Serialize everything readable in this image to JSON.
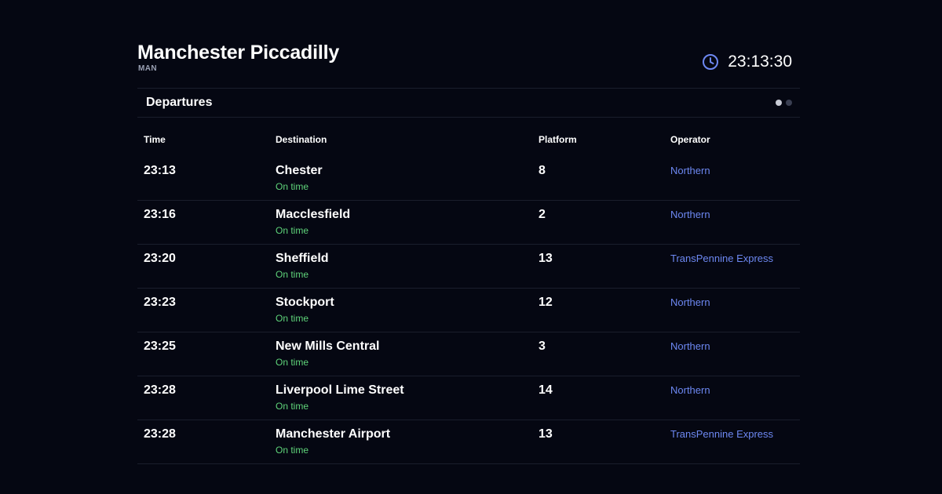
{
  "station": {
    "name": "Manchester Piccadilly",
    "code": "MAN"
  },
  "clock": {
    "time": "23:13:30",
    "icon": "clock-icon",
    "accent_color": "#6d88f2"
  },
  "section": {
    "title": "Departures",
    "pages": 2,
    "active_page": 1
  },
  "columns": {
    "time": "Time",
    "destination": "Destination",
    "platform": "Platform",
    "operator": "Operator"
  },
  "departures": [
    {
      "time": "23:13",
      "destination": "Chester",
      "status": "On time",
      "platform": "8",
      "operator": "Northern"
    },
    {
      "time": "23:16",
      "destination": "Macclesfield",
      "status": "On time",
      "platform": "2",
      "operator": "Northern"
    },
    {
      "time": "23:20",
      "destination": "Sheffield",
      "status": "On time",
      "platform": "13",
      "operator": "TransPennine Express"
    },
    {
      "time": "23:23",
      "destination": "Stockport",
      "status": "On time",
      "platform": "12",
      "operator": "Northern"
    },
    {
      "time": "23:25",
      "destination": "New Mills Central",
      "status": "On time",
      "platform": "3",
      "operator": "Northern"
    },
    {
      "time": "23:28",
      "destination": "Liverpool Lime Street",
      "status": "On time",
      "platform": "14",
      "operator": "Northern"
    },
    {
      "time": "23:28",
      "destination": "Manchester Airport",
      "status": "On time",
      "platform": "13",
      "operator": "TransPennine Express"
    }
  ],
  "colors": {
    "background": "#050712",
    "on_time": "#5fd47a",
    "operator_link": "#6d88f2",
    "divider": "#1a1e2c"
  }
}
